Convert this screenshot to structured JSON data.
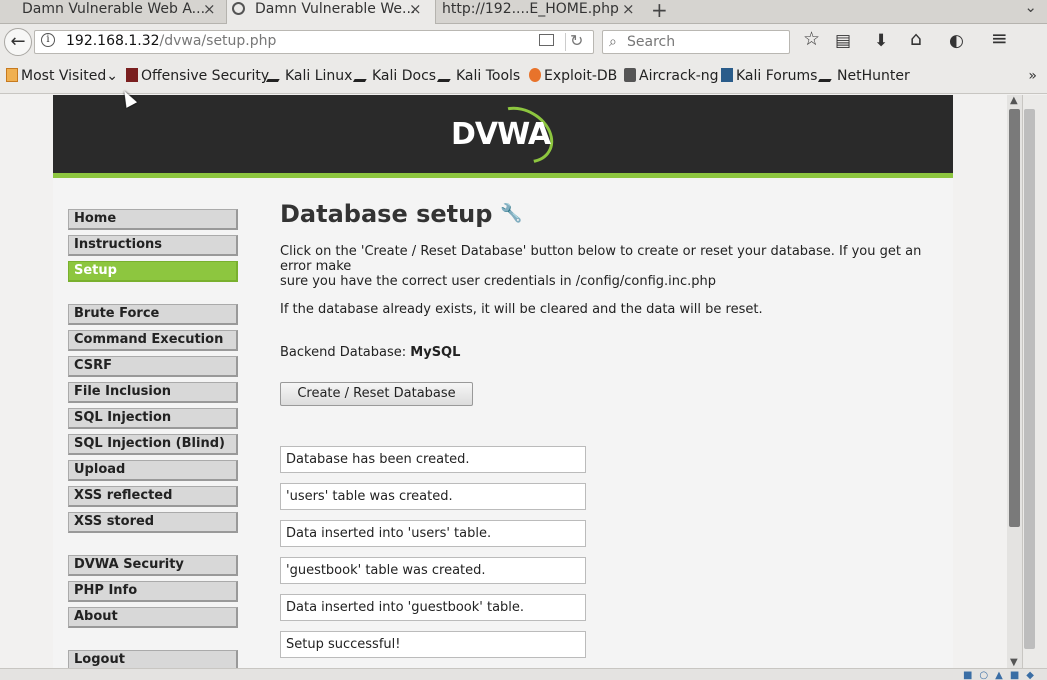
{
  "tabs": [
    {
      "label": "Damn Vulnerable Web A...",
      "close": "×"
    },
    {
      "label": "Damn Vulnerable We...",
      "close": "×"
    },
    {
      "label": "http://192....E_HOME.php",
      "close": "×"
    }
  ],
  "new_tab": "+",
  "tab_scroll": "⌄",
  "nav": {
    "back": "←",
    "info": "i",
    "url_host": "192.168.1.32",
    "url_path": "/dvwa/setup.php",
    "reload": "↻",
    "search_placeholder": "Search",
    "search_icon": "⌕",
    "star": "☆",
    "reading_list": "▤",
    "download": "⬇",
    "home": "⌂",
    "pocket": "◐",
    "menu": "≡"
  },
  "bookmarks": {
    "items": [
      {
        "label": "Most Visited",
        "icon": "folder-icon",
        "suffix": "⌄"
      },
      {
        "label": "Offensive Security",
        "icon": "offsec-icon"
      },
      {
        "label": "Kali Linux",
        "icon": "kali-icon"
      },
      {
        "label": "Kali Docs",
        "icon": "kali-icon"
      },
      {
        "label": "Kali Tools",
        "icon": "kali-icon"
      },
      {
        "label": "Exploit-DB",
        "icon": "exploitdb-icon"
      },
      {
        "label": "Aircrack-ng",
        "icon": "aircrack-icon"
      },
      {
        "label": "Kali Forums",
        "icon": "forums-icon"
      },
      {
        "label": "NetHunter",
        "icon": "kali-icon"
      }
    ],
    "overflow": "»"
  },
  "dvwa": {
    "logo_text": "DVWA",
    "accent_color": "#8dc63f",
    "menu_group1": [
      "Home",
      "Instructions",
      "Setup"
    ],
    "menu_group2": [
      "Brute Force",
      "Command Execution",
      "CSRF",
      "File Inclusion",
      "SQL Injection",
      "SQL Injection (Blind)",
      "Upload",
      "XSS reflected",
      "XSS stored"
    ],
    "menu_group3": [
      "DVWA Security",
      "PHP Info",
      "About"
    ],
    "menu_group4": [
      "Logout"
    ],
    "selected": "Setup",
    "title": "Database setup",
    "wrench": "🔧",
    "intro_line1": "Click on the 'Create / Reset Database' button below to create or reset your database. If you get an error make",
    "intro_line2": "sure you have the correct user credentials in /config/config.inc.php",
    "clear_note": "If the database already exists, it will be cleared and the data will be reset.",
    "backend_label": "Backend Database:",
    "backend_value": "MySQL",
    "reset_button": "Create / Reset Database",
    "messages": [
      "Database has been created.",
      "'users' table was created.",
      "Data inserted into 'users' table.",
      "'guestbook' table was created.",
      "Data inserted into 'guestbook' table.",
      "Setup successful!"
    ]
  },
  "scroll": {
    "up": "▲",
    "down": "▼"
  }
}
